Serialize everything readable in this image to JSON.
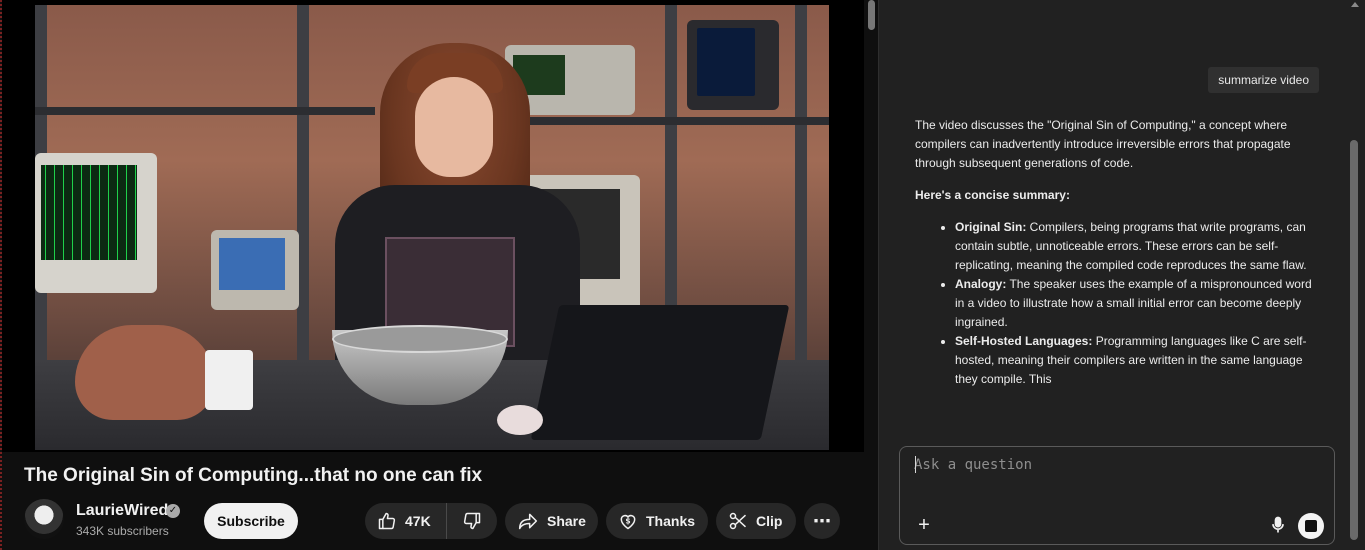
{
  "video": {
    "title": "The Original Sin of Computing...that no one can fix",
    "channel": {
      "name": "LaurieWired",
      "subscribers": "343K subscribers",
      "verified_icon": "checkmark-badge"
    },
    "actions": {
      "subscribe_label": "Subscribe",
      "like_count": "47K",
      "share_label": "Share",
      "thanks_label": "Thanks",
      "clip_label": "Clip",
      "more_label": "⋯"
    }
  },
  "assistant": {
    "user_message": "summarize video",
    "intro": "The video discusses the \"Original Sin of Computing,\" a concept where compilers can inadvertently introduce irreversible errors that propagate through subsequent generations of code.",
    "summary_heading": "Here's a concise summary:",
    "bullets": [
      {
        "term": "Original Sin:",
        "text": " Compilers, being programs that write programs, can contain subtle, unnoticeable errors. These errors can be self-replicating, meaning the compiled code reproduces the same flaw."
      },
      {
        "term": "Analogy:",
        "text": " The speaker uses the example of a mispronounced word in a video to illustrate how a small initial error can become deeply ingrained."
      },
      {
        "term": "Self-Hosted Languages:",
        "text": " Programming languages like C are self-hosted, meaning their compilers are written in the same language they compile. This"
      }
    ],
    "input": {
      "placeholder": "Ask a question",
      "value": ""
    },
    "icons": {
      "add": "plus-icon",
      "mic": "microphone-icon",
      "stop": "stop-icon"
    }
  },
  "colors": {
    "page_bg": "#0f0f0f",
    "panel_bg": "#212121",
    "pill_bg": "#272727",
    "subscribe_bg": "#f1f1f1"
  }
}
